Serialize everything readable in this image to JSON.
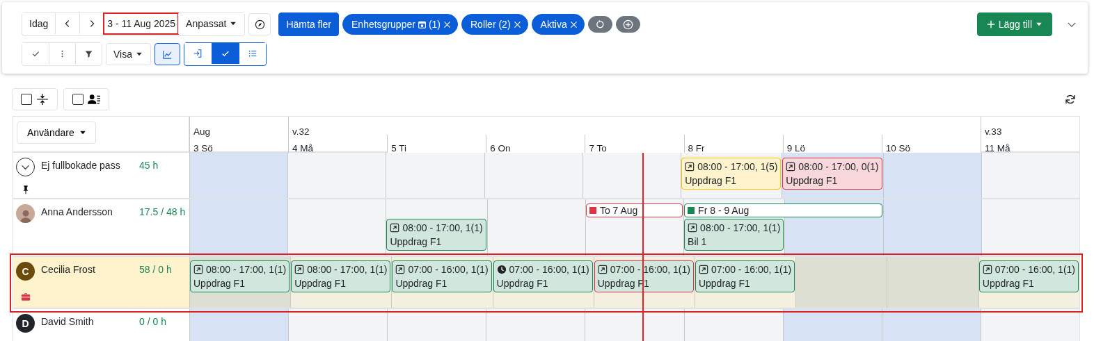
{
  "toolbar": {
    "today_button": "Idag",
    "date_range": {
      "value": "3 - 11 Aug 2025",
      "highlighted": true
    },
    "view_dropdown": "Anpassat",
    "fetch_button": "Hämta fler",
    "filters": [
      {
        "label": "Enhetsgrupper",
        "suffix": "(1)"
      },
      {
        "label": "Roller (2)"
      },
      {
        "label": "Aktiva"
      }
    ],
    "add_button": "Lägg till",
    "show_dropdown": "Visa",
    "chart_toggle": {
      "on": true
    },
    "view_modes": [
      {
        "kind": "import",
        "selected": false
      },
      {
        "kind": "check",
        "selected": true
      },
      {
        "kind": "list",
        "selected": false
      }
    ]
  },
  "options": [
    {
      "kind": "compress",
      "checked": false
    },
    {
      "kind": "users",
      "checked": false
    }
  ],
  "calendar": {
    "user_menu": "Användare",
    "days": [
      {
        "top": "Aug",
        "label": "3 Sö",
        "weekend": true
      },
      {
        "top": "v.32",
        "label": "4 Må",
        "weekend": false
      },
      {
        "label": "5 Ti",
        "weekend": false
      },
      {
        "label": "6 On",
        "weekend": false
      },
      {
        "label": "7 To",
        "weekend": false
      },
      {
        "label": "8 Fr",
        "weekend": false
      },
      {
        "label": "9 Lö",
        "weekend": true
      },
      {
        "label": "10 Sö",
        "weekend": true
      },
      {
        "top": "v.33",
        "label": "11 Må",
        "weekend": false
      }
    ],
    "rows": [
      {
        "avatar": {
          "kind": "expand"
        },
        "badge": {
          "kind": "pin"
        },
        "name": "Ej fullbokade pass",
        "hours": "45 h",
        "selected": false,
        "highlighted": false,
        "cells": [
          {},
          {},
          {},
          {},
          {},
          {
            "shifts": [
              {
                "kind": "partial",
                "clock": false,
                "time": "08:00 - 17:00, 1(5)",
                "task": "Uppdrag F1"
              }
            ]
          },
          {
            "shifts": [
              {
                "kind": "unfilled",
                "clock": false,
                "time": "08:00 - 17:00, 0(1)",
                "task": "Uppdrag F1"
              }
            ]
          },
          {},
          {}
        ]
      },
      {
        "avatar": {
          "kind": "photo"
        },
        "name": "Anna Andersson",
        "hours": "17.5 / 48 h",
        "selected": false,
        "highlighted": false,
        "cells": [
          {},
          {},
          {
            "shifts": [
              {
                "kind": "booked",
                "clock": false,
                "time": "08:00 - 17:00, 1(1)",
                "task": "Uppdrag F1"
              }
            ]
          },
          {},
          {
            "absence": {
              "label": "To 7 Aug",
              "color": "#dc3545",
              "extends_next_day": false
            }
          },
          {
            "absence": {
              "label": "Fr 8 - 9 Aug",
              "color": "#198754",
              "extends_next_day": true
            },
            "shifts": [
              {
                "kind": "booked",
                "clock": false,
                "time": "08:00 - 17:00, 1(1)",
                "task": "Bil 1"
              }
            ]
          },
          {},
          {},
          {}
        ]
      },
      {
        "avatar": {
          "kind": "initial",
          "letter": "C",
          "color": "#6b4b0a"
        },
        "badge": {
          "kind": "briefcase"
        },
        "name": "Cecilia Frost",
        "hours": "58 / 0 h",
        "selected": true,
        "highlighted": true,
        "cells": [
          {
            "shifts": [
              {
                "kind": "booked",
                "clock": false,
                "time": "08:00 - 17:00, 1(1)",
                "task": "Uppdrag F1"
              }
            ]
          },
          {
            "shifts": [
              {
                "kind": "booked",
                "clock": false,
                "time": "08:00 - 17:00, 1(1)",
                "task": "Uppdrag F1"
              }
            ]
          },
          {
            "shifts": [
              {
                "kind": "booked",
                "clock": false,
                "time": "07:00 - 16:00, 1(1)",
                "task": "Uppdrag F1"
              }
            ]
          },
          {
            "shifts": [
              {
                "kind": "booked",
                "clock": true,
                "time": "07:00 - 16:00, 1(1)",
                "task": "Uppdrag F1"
              }
            ]
          },
          {
            "shifts": [
              {
                "kind": "conflict",
                "clock": false,
                "time": "07:00 - 16:00, 1(1)",
                "task": "Uppdrag F1"
              }
            ]
          },
          {
            "shifts": [
              {
                "kind": "booked",
                "clock": false,
                "time": "07:00 - 16:00, 1(1)",
                "task": "Uppdrag F1"
              }
            ]
          },
          {},
          {},
          {
            "shifts": [
              {
                "kind": "booked",
                "clock": false,
                "time": "07:00 - 16:00, 1(1)",
                "task": "Uppdrag F1"
              }
            ]
          }
        ]
      },
      {
        "avatar": {
          "kind": "initial",
          "letter": "D",
          "color": "#212529"
        },
        "name": "David Smith",
        "hours": "0 / 0 h",
        "selected": false,
        "highlighted": false,
        "cells": [
          {},
          {},
          {},
          {},
          {},
          {},
          {},
          {},
          {}
        ]
      }
    ]
  }
}
